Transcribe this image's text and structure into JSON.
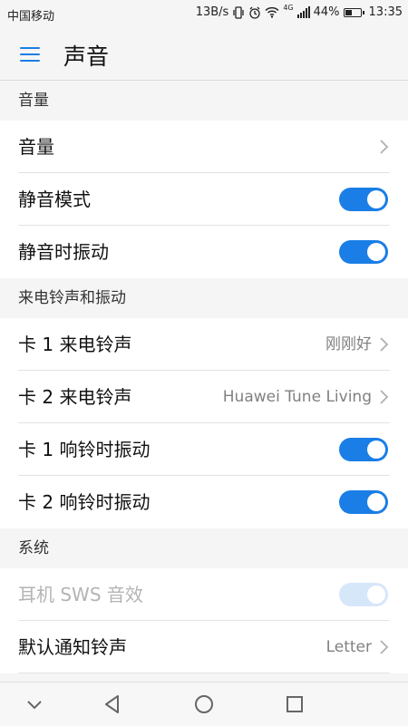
{
  "status_bar": {
    "carrier": "中国移动",
    "speed": "13B/s",
    "network_badge": "4G",
    "battery_percent": "44%",
    "battery_level": 0.44,
    "time": "13:35",
    "icons": [
      "vibrate-icon",
      "alarm-icon",
      "wifi-icon",
      "signal-icon",
      "battery-icon"
    ]
  },
  "app_bar": {
    "title": "声音",
    "menu_icon": "hamburger-menu-icon"
  },
  "sections": [
    {
      "header": "音量",
      "items": [
        {
          "label": "音量",
          "type": "chevron"
        },
        {
          "label": "静音模式",
          "type": "toggle",
          "on": true
        },
        {
          "label": "静音时振动",
          "type": "toggle",
          "on": true
        }
      ]
    },
    {
      "header": "来电铃声和振动",
      "items": [
        {
          "label": "卡 1 来电铃声",
          "type": "chevron",
          "value": "刚刚好"
        },
        {
          "label": "卡 2 来电铃声",
          "type": "chevron",
          "value": "Huawei Tune Living"
        },
        {
          "label": "卡 1 响铃时振动",
          "type": "toggle",
          "on": true
        },
        {
          "label": "卡 2 响铃时振动",
          "type": "toggle",
          "on": true
        }
      ]
    },
    {
      "header": "系统",
      "items": [
        {
          "label": "耳机 SWS 音效",
          "type": "toggle",
          "on": true,
          "disabled": true
        },
        {
          "label": "默认通知铃声",
          "type": "chevron",
          "value": "Letter"
        }
      ]
    }
  ],
  "nav_bar": {
    "buttons": [
      "collapse-icon",
      "back-icon",
      "home-icon",
      "recents-icon"
    ]
  },
  "colors": {
    "accent": "#1a7ee6",
    "background": "#f5f5f5",
    "row": "#ffffff",
    "secondary_text": "#808080"
  }
}
